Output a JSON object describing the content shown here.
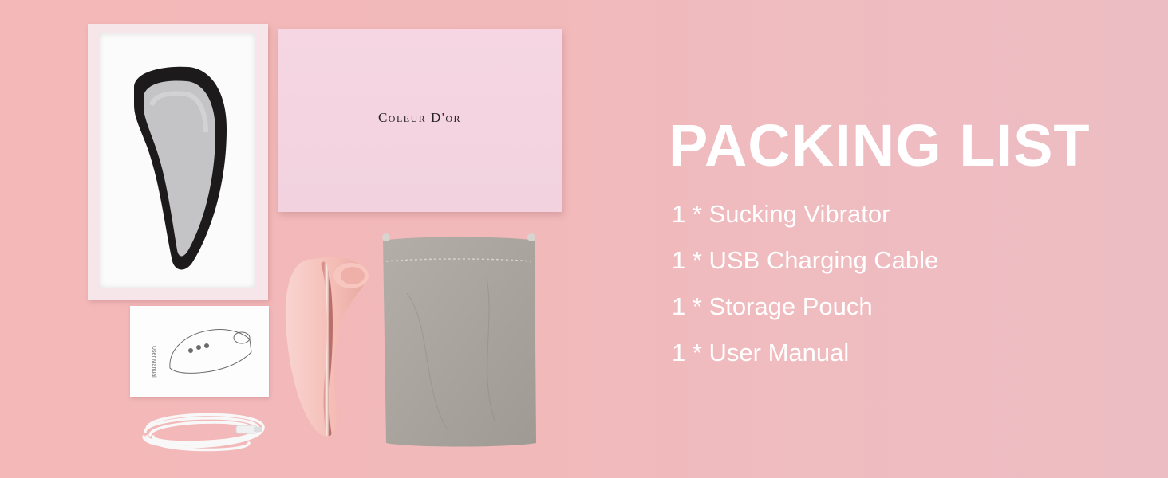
{
  "brand": {
    "name": "Coleur D'or"
  },
  "packing_list": {
    "title": "PACKING LIST",
    "items": [
      "1 * Sucking Vibrator",
      "1 * USB Charging Cable",
      "1 * Storage Pouch",
      "1 * User Manual"
    ]
  },
  "manual": {
    "title": "User Manual"
  },
  "colors": {
    "background": "#f4b8b8",
    "lid": "#f5d6e2",
    "pouch": "#a8a39d",
    "device": "#f6c3bc",
    "text": "#ffffff"
  }
}
